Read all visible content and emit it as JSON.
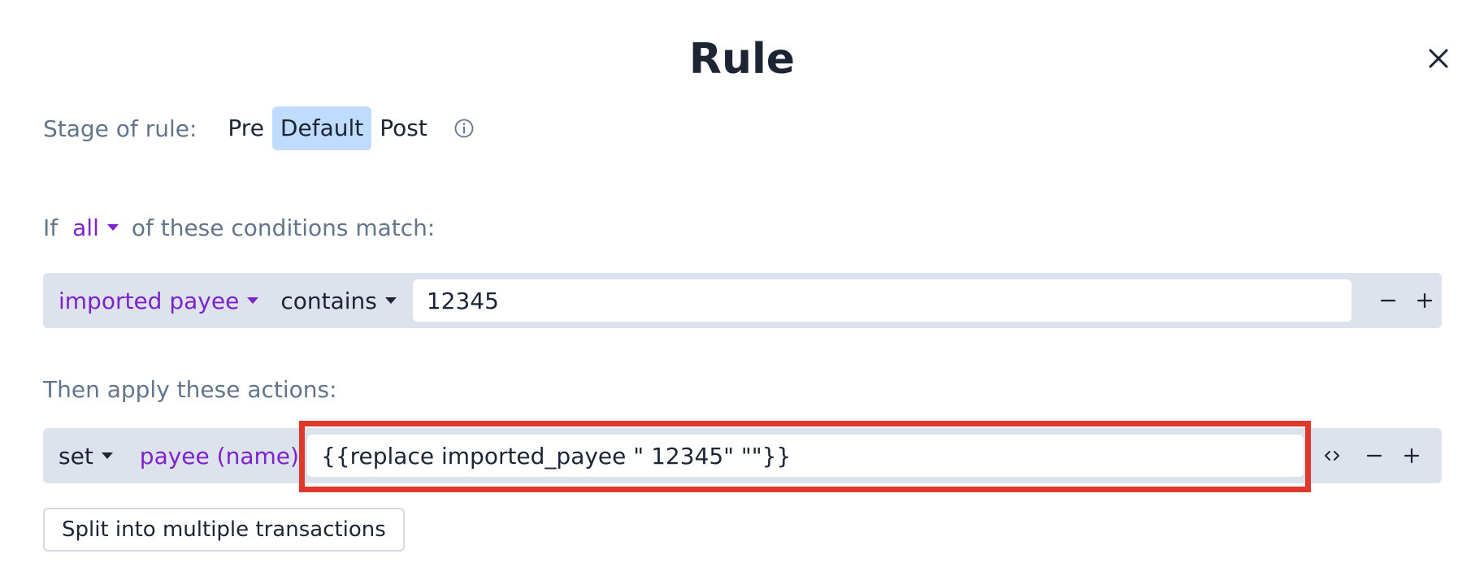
{
  "dialog": {
    "title": "Rule"
  },
  "stage": {
    "label": "Stage of rule:",
    "options": [
      "Pre",
      "Default",
      "Post"
    ],
    "selected": "Default"
  },
  "conditions": {
    "prefix": "If",
    "op_value": "all",
    "suffix": "of these conditions match:",
    "rows": [
      {
        "field": "imported payee",
        "op": "contains",
        "value": "12345"
      }
    ]
  },
  "actions": {
    "header": "Then apply these actions:",
    "rows": [
      {
        "op": "set",
        "field": "payee (name)",
        "value": "{{replace imported_payee \" 12345\" \"\"}}"
      }
    ]
  },
  "split_button": "Split into multiple transactions",
  "colors": {
    "accent_purple": "#7e22ce",
    "selected_stage_bg": "#bfdbfe",
    "row_bg": "#dde3ec",
    "highlight_red": "#e0392b"
  },
  "icons": {
    "close": "close-icon",
    "info": "info-icon",
    "caret": "caret-down-icon",
    "minus": "minus-icon",
    "plus": "plus-icon",
    "code": "code-icon"
  }
}
